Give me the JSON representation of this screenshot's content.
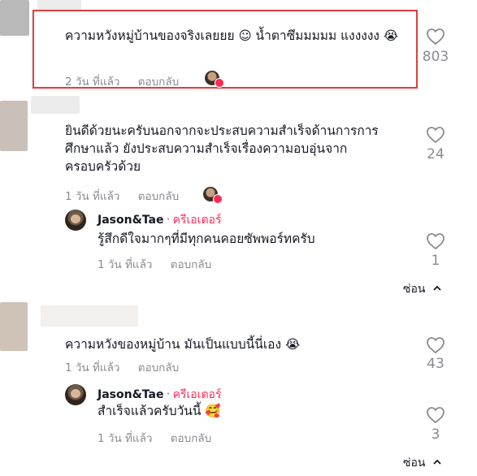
{
  "comments": [
    {
      "text": "ความหวังหมู่บ้านของจริงเลยยย ☺ น้ำตาซึมมมมม แงงงงง 😭",
      "time": "2 วัน ที่แล้ว",
      "reply_label": "ตอบกลับ",
      "likes": "803"
    },
    {
      "text_lines": [
        "ยินดีด้วยนะครับนอกจากจะประสบความสำเร็จด้านการการ",
        "ศึกษาแล้ว ยังประสบความสำเร็จเรื่องความอบอุ่นจาก",
        "ครอบครัวด้วย"
      ],
      "time": "1 วัน ที่แล้ว",
      "reply_label": "ตอบกลับ",
      "likes": "24",
      "reply": {
        "author": "Jason&Tae",
        "role": "ครีเอเตอร์",
        "text": "รู้สึกดีใจมากๆที่มีทุกคนคอยซัพพอร์ทครับ",
        "time": "1 วัน ที่แล้ว",
        "reply_label": "ตอบกลับ",
        "likes": "1"
      },
      "hide_label": "ซ่อน"
    },
    {
      "text": "ความหวังของหมู่บ้าน มันเป็นแบบนี้นี่เอง 😭",
      "time": "1 วัน ที่แล้ว",
      "reply_label": "ตอบกลับ",
      "likes": "43",
      "reply": {
        "author": "Jason&Tae",
        "role": "ครีเอเตอร์",
        "text": "สำเร็จแล้วครับวันนี้ 🥰",
        "time": "1 วัน ที่แล้ว",
        "reply_label": "ตอบกลับ",
        "likes": "3"
      },
      "hide_label": "ซ่อน"
    }
  ],
  "icons": {
    "like": "heart-outline-icon",
    "hide": "chevron-up-icon"
  },
  "colors": {
    "highlight_border": "#e0403e",
    "creator": "#fe2c55",
    "muted": "#8a8b91",
    "text": "#161823"
  }
}
